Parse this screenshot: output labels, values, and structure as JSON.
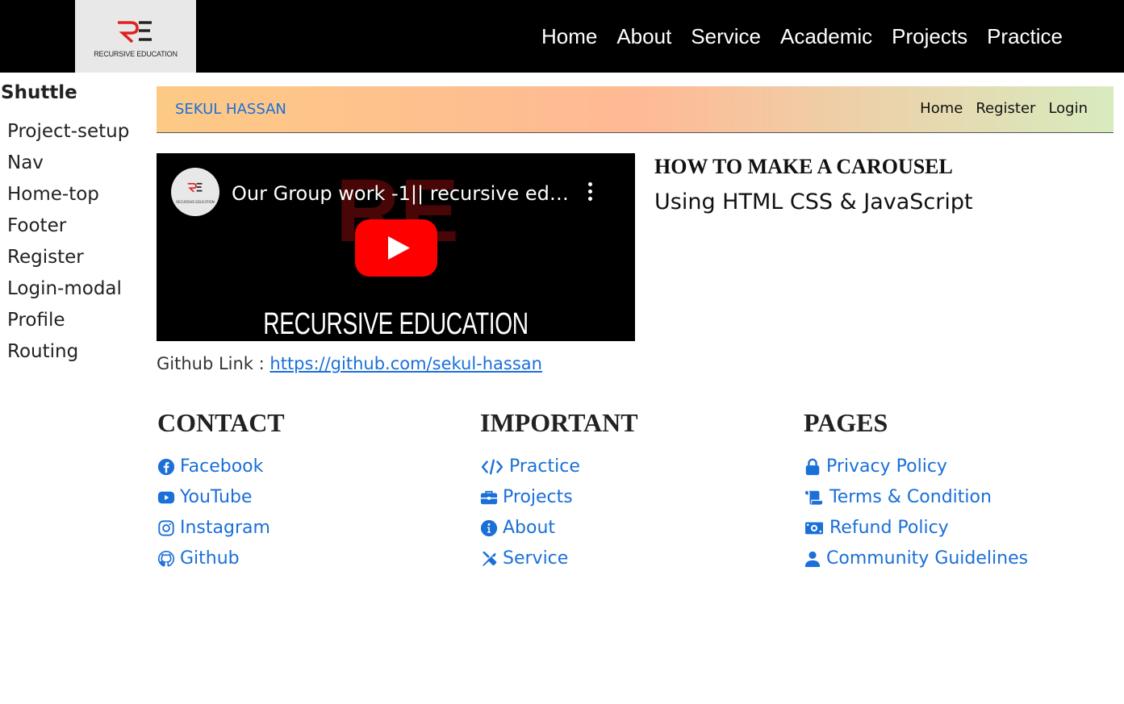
{
  "brand": {
    "logo_text": "RECURSIVE EDUCATION",
    "accent_color": "#e02020"
  },
  "topnav": {
    "items": [
      "Home",
      "About",
      "Service",
      "Academic",
      "Projects",
      "Practice"
    ]
  },
  "sidebar": {
    "title": "Shuttle",
    "items": [
      "Project-setup",
      "Nav",
      "Home-top",
      "Footer",
      "Register",
      "Login-modal",
      "Profile",
      "Routing"
    ]
  },
  "subnav": {
    "brand": "SEKUL HASSAN",
    "links": [
      "Home",
      "Register",
      "Login"
    ]
  },
  "video": {
    "title": "Our Group work -1|| recursive education",
    "caption": "RECURSIVE EDUCATION",
    "channel_icon": "recursive-education-logo"
  },
  "content": {
    "heading": "HOW TO MAKE A CAROUSEL",
    "subheading": "Using HTML CSS & JavaScript",
    "github_label": "Github Link : ",
    "github_url": "https://github.com/sekul-hassan"
  },
  "footer": {
    "contact": {
      "title": "CONTACT",
      "items": [
        {
          "label": "Facebook",
          "icon": "facebook-icon"
        },
        {
          "label": "YouTube",
          "icon": "youtube-icon"
        },
        {
          "label": "Instagram",
          "icon": "instagram-icon"
        },
        {
          "label": "Github",
          "icon": "github-icon"
        }
      ]
    },
    "important": {
      "title": "IMPORTANT",
      "items": [
        {
          "label": "Practice",
          "icon": "code-icon"
        },
        {
          "label": "Projects",
          "icon": "briefcase-icon"
        },
        {
          "label": "About",
          "icon": "info-icon"
        },
        {
          "label": "Service",
          "icon": "tools-icon"
        }
      ]
    },
    "pages": {
      "title": "PAGES",
      "items": [
        {
          "label": "Privacy Policy",
          "icon": "lock-icon"
        },
        {
          "label": "Terms & Condition",
          "icon": "scroll-icon"
        },
        {
          "label": "Refund Policy",
          "icon": "money-icon"
        },
        {
          "label": "Community Guidelines",
          "icon": "user-icon"
        }
      ]
    },
    "link_color": "#1a6fd8"
  }
}
